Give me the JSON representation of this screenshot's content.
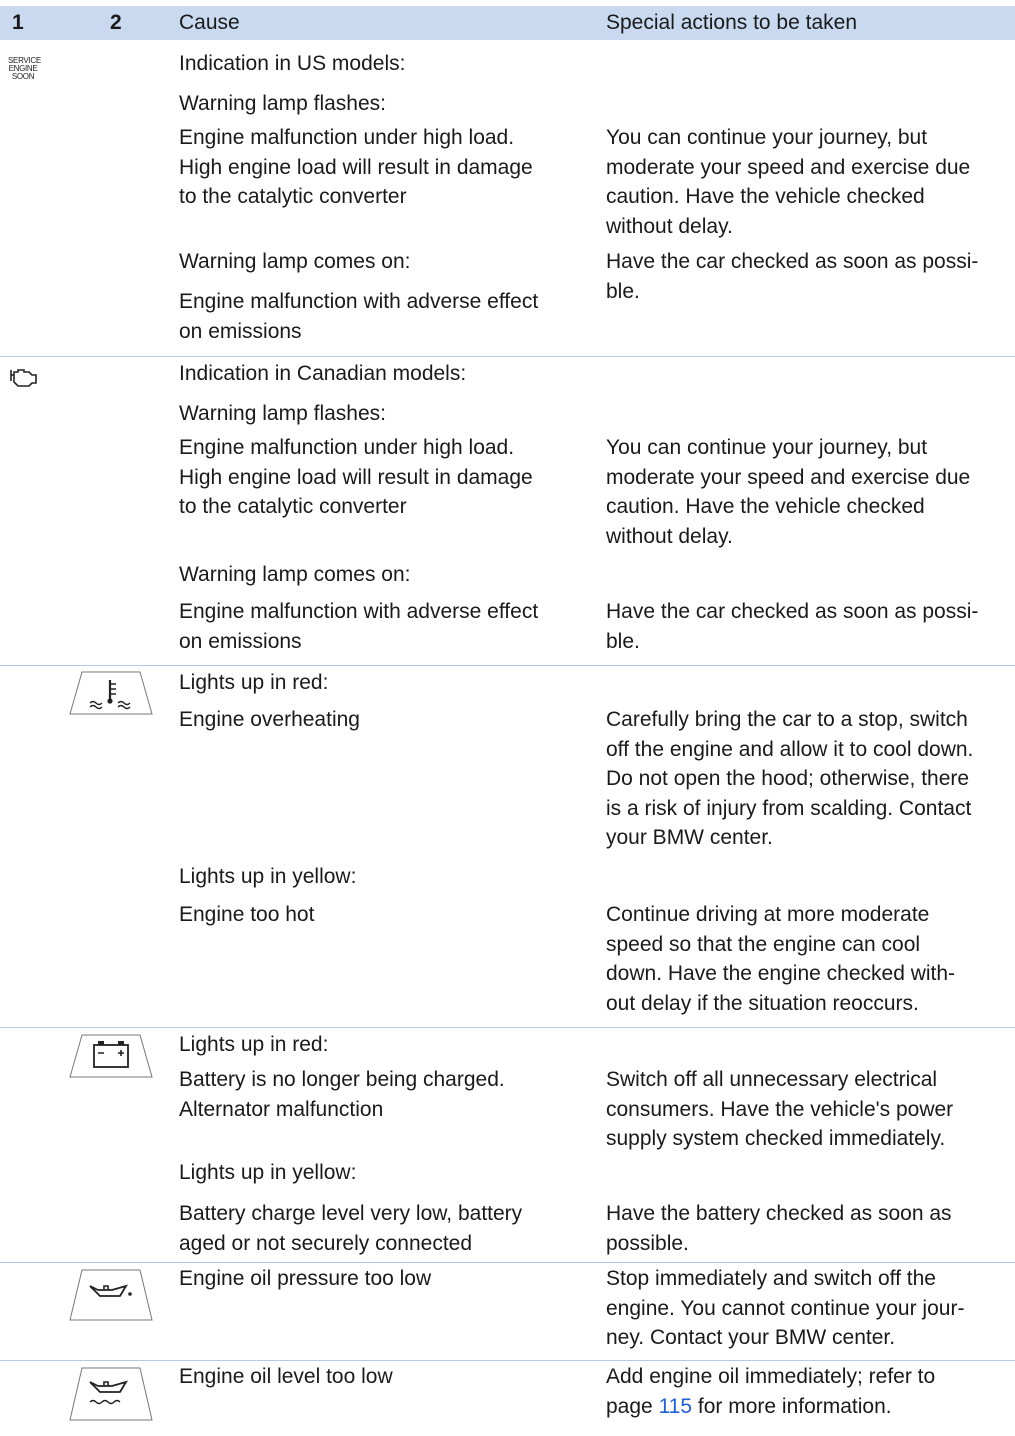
{
  "header": {
    "col1": "1",
    "col2": "2",
    "cause": "Cause",
    "actions": "Special actions to be taken"
  },
  "icons": {
    "service_engine_soon": {
      "name": "service-engine-soon-icon",
      "line1": "SERVICE",
      "line2": "ENGINE",
      "line3": "SOON"
    },
    "check_engine": "check-engine-icon",
    "coolant_temperature": "coolant-temperature-icon",
    "battery": "battery-icon",
    "oil_pressure": "oil-pressure-icon",
    "oil_level": "oil-level-icon"
  },
  "sections": {
    "us": {
      "label": "Indication in US models:",
      "flash_label": "Warning lamp flashes:",
      "flash_cause": [
        "Engine malfunction under high load.",
        "High engine load will result in damage",
        "to the catalytic converter"
      ],
      "flash_action": [
        "You can continue your journey, but",
        "moderate your speed and exercise due",
        "caution. Have the vehicle checked",
        "without delay."
      ],
      "on_label": "Warning lamp comes on:",
      "on_cause": [
        "Engine malfunction with adverse effect",
        "on emissions"
      ],
      "on_action": [
        "Have the car checked as soon as possi-",
        "ble."
      ]
    },
    "canada": {
      "label": "Indication in Canadian models:",
      "flash_label": "Warning lamp flashes:",
      "flash_cause": [
        "Engine malfunction under high load.",
        "High engine load will result in damage",
        "to the catalytic converter"
      ],
      "flash_action": [
        "You can continue your journey, but",
        "moderate your speed and exercise due",
        "caution. Have the vehicle checked",
        "without delay."
      ],
      "on_label": "Warning lamp comes on:",
      "on_cause": [
        "Engine malfunction with adverse effect",
        "on emissions"
      ],
      "on_action": [
        "Have the car checked as soon as possi-",
        "ble."
      ]
    },
    "coolant": {
      "red_label": "Lights up in red:",
      "red_cause": "Engine overheating",
      "red_action": [
        "Carefully bring the car to a stop, switch",
        "off the engine and allow it to cool down.",
        "Do not open the hood; otherwise, there",
        "is a risk of injury from scalding. Contact",
        "your BMW center."
      ],
      "yellow_label": "Lights up in yellow:",
      "yellow_cause": "Engine too hot",
      "yellow_action": [
        "Continue driving at more moderate",
        "speed so that the engine can cool",
        "down. Have the engine checked with-",
        "out delay if the situation reoccurs."
      ]
    },
    "battery": {
      "red_label": "Lights up in red:",
      "red_cause": [
        "Battery is no longer being charged.",
        "Alternator malfunction"
      ],
      "red_action": [
        "Switch off all unnecessary electrical",
        "consumers. Have the vehicle's power",
        "supply system checked immediately."
      ],
      "yellow_label": "Lights up in yellow:",
      "yellow_cause": [
        "Battery charge level very low, battery",
        "aged or not securely connected"
      ],
      "yellow_action": [
        "Have the battery checked as soon as",
        "possible."
      ]
    },
    "oil_pressure": {
      "cause": "Engine oil pressure too low",
      "action": [
        "Stop immediately and switch off the",
        "engine. You cannot continue your jour-",
        "ney. Contact your BMW center."
      ]
    },
    "oil_level": {
      "cause": "Engine oil level too low",
      "action_line1": "Add engine oil immediately; refer to",
      "action_prefix": "page ",
      "page_link": "115",
      "action_suffix": " for more information."
    }
  }
}
